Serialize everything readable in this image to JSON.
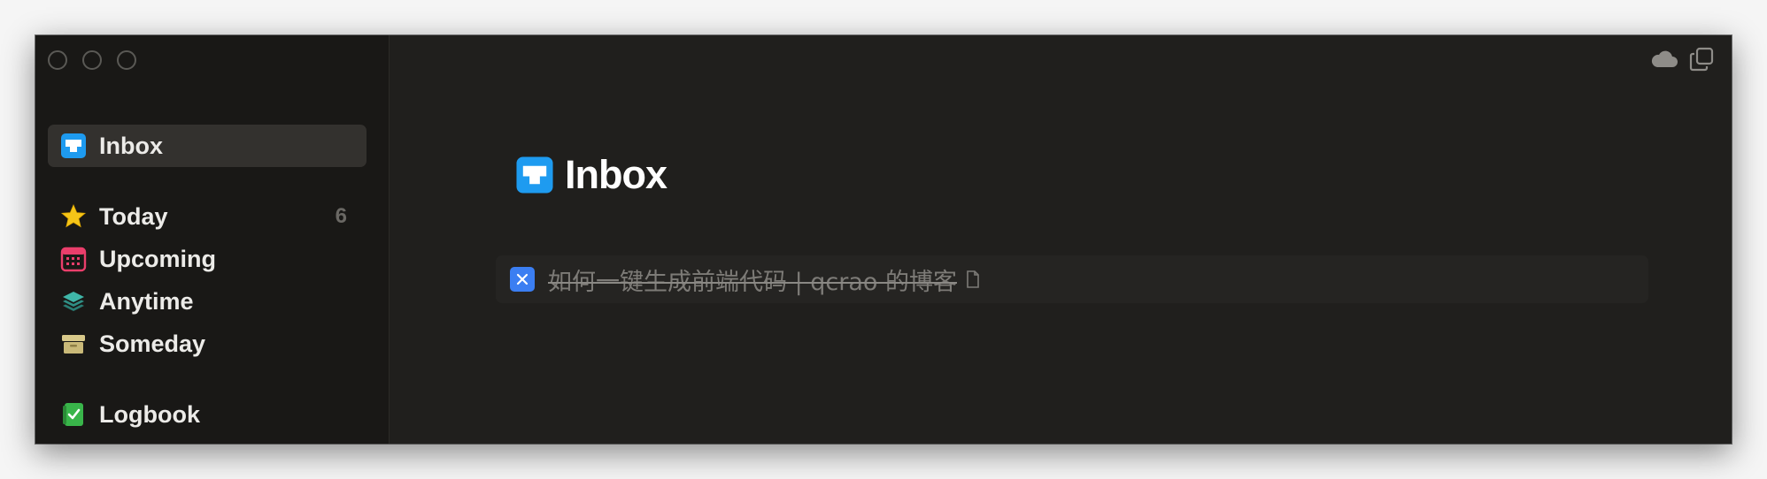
{
  "sidebar": {
    "items": [
      {
        "label": "Inbox",
        "icon": "inbox-icon",
        "selected": true
      },
      {
        "label": "Today",
        "icon": "star-icon",
        "count": "6"
      },
      {
        "label": "Upcoming",
        "icon": "calendar-icon"
      },
      {
        "label": "Anytime",
        "icon": "layers-icon"
      },
      {
        "label": "Someday",
        "icon": "archive-box-icon"
      },
      {
        "label": "Logbook",
        "icon": "logbook-icon"
      }
    ]
  },
  "toolbar": {
    "icons": [
      "cloud-icon",
      "duplicate-window-icon"
    ]
  },
  "main": {
    "title": "Inbox",
    "title_icon": "inbox-icon",
    "tasks": [
      {
        "title": "如何一键生成前端代码 | qcrao 的博客",
        "completed": true,
        "has_note": true
      }
    ]
  },
  "colors": {
    "inbox_blue": "#1e9bf0",
    "star_yellow": "#f5c518",
    "upcoming_red": "#ea3e6b",
    "anytime_teal": "#3fb6a8",
    "someday_tan": "#d8c98a",
    "logbook_green": "#39b54a",
    "checkbox_blue": "#3b7ef2",
    "window_bg": "#201f1d",
    "sidebar_bg": "#191816"
  }
}
